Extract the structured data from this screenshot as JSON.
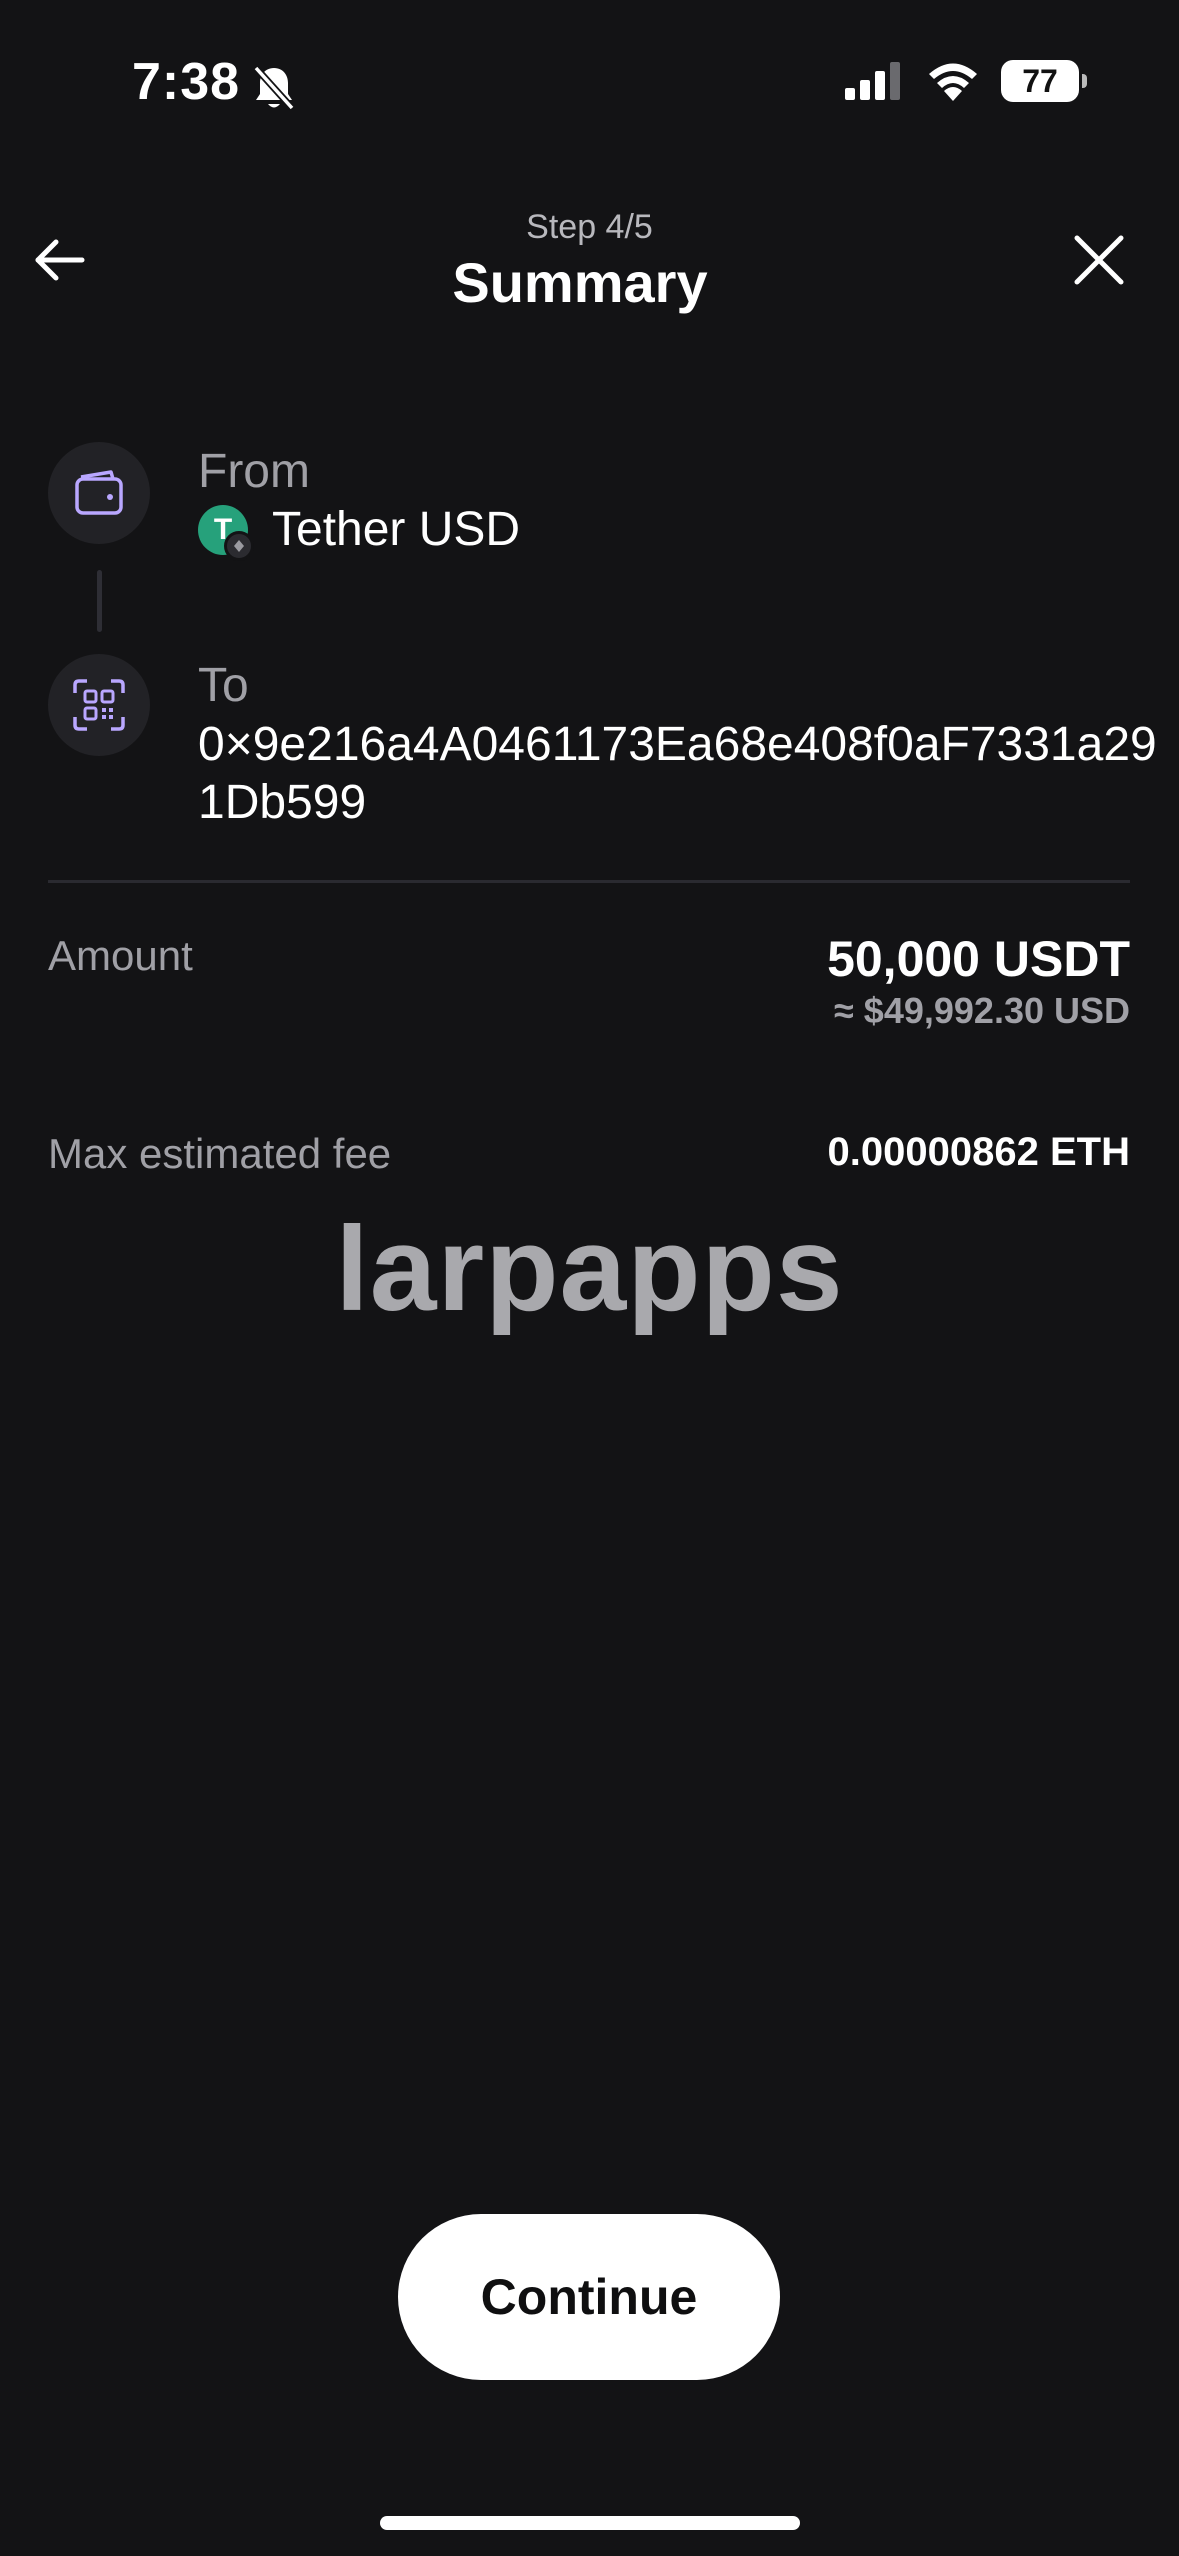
{
  "status_bar": {
    "time": "7:38",
    "battery_level": "77",
    "icons": [
      "bell-slash-icon",
      "cellular-signal-icon",
      "wifi-icon",
      "battery-icon"
    ]
  },
  "header": {
    "step_label": "Step 4/5",
    "title": "Summary",
    "back_icon": "arrow-left-icon",
    "close_icon": "close-icon"
  },
  "route": {
    "from_label": "From",
    "from_icon": "wallet-icon",
    "token_name": "Tether USD",
    "token_logo_letter": "T",
    "to_label": "To",
    "to_icon": "qr-scan-icon",
    "to_address": "0×9e216a4A0461173Ea68e408f0aF7331a291Db599"
  },
  "amount": {
    "label": "Amount",
    "value": "50,000 USDT",
    "usd_value": "≈ $49,992.30 USD"
  },
  "fee": {
    "label": "Max estimated fee",
    "value": "0.00000862 ETH"
  },
  "watermark": "larpapps",
  "actions": {
    "continue_label": "Continue"
  },
  "colors": {
    "background": "#131315",
    "accent_icon": "#b9a7ff",
    "tether_green": "#26a17b",
    "muted_text": "#a0a0a6"
  }
}
